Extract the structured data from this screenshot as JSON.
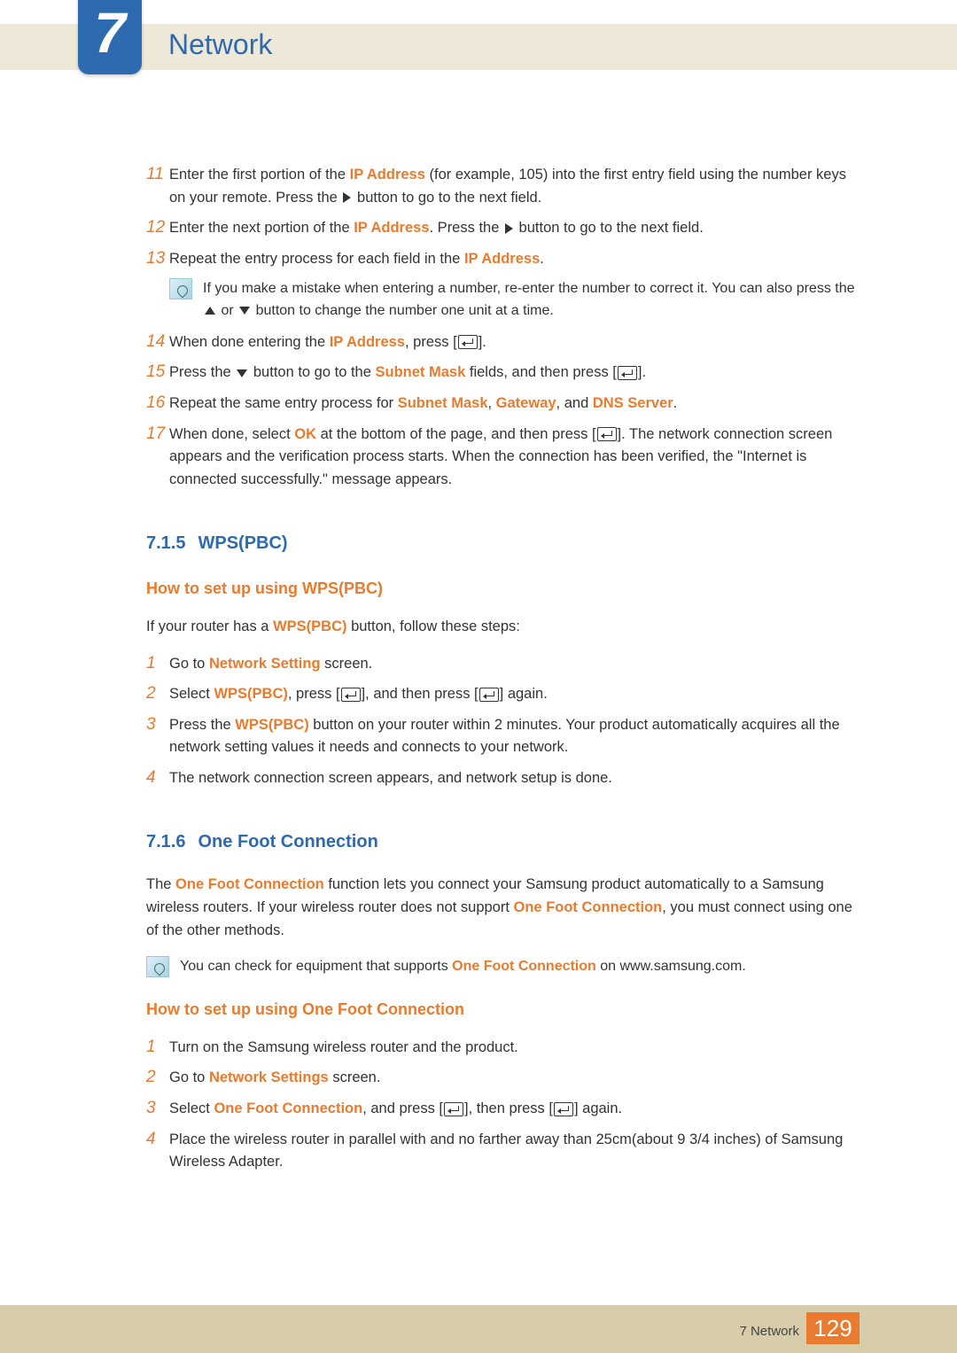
{
  "chapter": {
    "number": "7",
    "title": "Network"
  },
  "steps_a": [
    {
      "num": "11",
      "parts": [
        {
          "t": "Enter the first portion of the "
        },
        {
          "t": "IP Address",
          "c": "hl"
        },
        {
          "t": " (for example, 105) into the first entry field using the number keys on your remote. Press the "
        },
        {
          "icon": "tri-right"
        },
        {
          "t": " button to go to the next field."
        }
      ]
    },
    {
      "num": "12",
      "parts": [
        {
          "t": "Enter the next portion of the "
        },
        {
          "t": "IP Address",
          "c": "hl"
        },
        {
          "t": ". Press the "
        },
        {
          "icon": "tri-right"
        },
        {
          "t": " button to go to the next field."
        }
      ]
    },
    {
      "num": "13",
      "parts": [
        {
          "t": "Repeat the entry process for each field in the "
        },
        {
          "t": "IP Address",
          "c": "hl"
        },
        {
          "t": "."
        }
      ]
    }
  ],
  "note_a": [
    {
      "t": "If you make a mistake when entering a number, re-enter the number to correct it. You can also press the "
    },
    {
      "icon": "tri-up"
    },
    {
      "t": " or "
    },
    {
      "icon": "tri-down"
    },
    {
      "t": " button to change the number one unit at a time."
    }
  ],
  "steps_b": [
    {
      "num": "14",
      "parts": [
        {
          "t": "When done entering the "
        },
        {
          "t": "IP Address",
          "c": "hl"
        },
        {
          "t": ", press ["
        },
        {
          "icon": "enter"
        },
        {
          "t": "]."
        }
      ]
    },
    {
      "num": "15",
      "parts": [
        {
          "t": "Press the "
        },
        {
          "icon": "tri-down"
        },
        {
          "t": " button to go to the "
        },
        {
          "t": "Subnet Mask",
          "c": "hl"
        },
        {
          "t": " fields, and then press ["
        },
        {
          "icon": "enter"
        },
        {
          "t": "]."
        }
      ]
    },
    {
      "num": "16",
      "parts": [
        {
          "t": "Repeat the same entry process for "
        },
        {
          "t": "Subnet Mask",
          "c": "hl"
        },
        {
          "t": ", "
        },
        {
          "t": "Gateway",
          "c": "hl"
        },
        {
          "t": ", and "
        },
        {
          "t": "DNS Server",
          "c": "hl"
        },
        {
          "t": "."
        }
      ]
    },
    {
      "num": "17",
      "parts": [
        {
          "t": "When done, select "
        },
        {
          "t": "OK",
          "c": "hl"
        },
        {
          "t": " at the bottom of the page, and then press ["
        },
        {
          "icon": "enter"
        },
        {
          "t": "]. The network connection screen appears and the verification process starts. When the connection has been verified, the \"Internet is connected successfully.\" message appears."
        }
      ]
    }
  ],
  "section_wps": {
    "num": "7.1.5",
    "title": "WPS(PBC)"
  },
  "wps_subtitle": "How to set up using WPS(PBC)",
  "wps_intro": [
    {
      "t": "If your router has a "
    },
    {
      "t": "WPS(PBC)",
      "c": "hl"
    },
    {
      "t": " button, follow these steps:"
    }
  ],
  "wps_steps": [
    {
      "num": "1",
      "parts": [
        {
          "t": "Go to "
        },
        {
          "t": "Network Setting",
          "c": "hl"
        },
        {
          "t": " screen."
        }
      ]
    },
    {
      "num": "2",
      "parts": [
        {
          "t": "Select "
        },
        {
          "t": "WPS(PBC)",
          "c": "hl"
        },
        {
          "t": ", press ["
        },
        {
          "icon": "enter"
        },
        {
          "t": "], and then press ["
        },
        {
          "icon": "enter"
        },
        {
          "t": "] again."
        }
      ]
    },
    {
      "num": "3",
      "parts": [
        {
          "t": "Press the "
        },
        {
          "t": "WPS(PBC)",
          "c": "hl"
        },
        {
          "t": " button on your router within 2 minutes. Your product automatically acquires all the network setting values it needs and connects to your network."
        }
      ]
    },
    {
      "num": "4",
      "parts": [
        {
          "t": "The network connection screen appears, and network setup is done."
        }
      ]
    }
  ],
  "section_ofc": {
    "num": "7.1.6",
    "title": "One Foot Connection"
  },
  "ofc_intro": [
    {
      "t": "The "
    },
    {
      "t": "One Foot Connection",
      "c": "hl"
    },
    {
      "t": " function lets you connect your Samsung product automatically to a Samsung wireless routers. If your wireless router does not support "
    },
    {
      "t": "One Foot Connection",
      "c": "hl"
    },
    {
      "t": ", you must connect using one of the other methods."
    }
  ],
  "ofc_note": [
    {
      "t": "You can check for equipment that supports "
    },
    {
      "t": "One Foot Connection",
      "c": "hl"
    },
    {
      "t": " on www.samsung.com."
    }
  ],
  "ofc_subtitle": "How to set up using One Foot Connection",
  "ofc_steps": [
    {
      "num": "1",
      "parts": [
        {
          "t": "Turn on the Samsung wireless router and the product."
        }
      ]
    },
    {
      "num": "2",
      "parts": [
        {
          "t": "Go to "
        },
        {
          "t": "Network Settings",
          "c": "hl"
        },
        {
          "t": " screen."
        }
      ]
    },
    {
      "num": "3",
      "parts": [
        {
          "t": "Select "
        },
        {
          "t": "One Foot Connection",
          "c": "hl"
        },
        {
          "t": ", and press ["
        },
        {
          "icon": "enter"
        },
        {
          "t": "], then press ["
        },
        {
          "icon": "enter"
        },
        {
          "t": "] again."
        }
      ]
    },
    {
      "num": "4",
      "parts": [
        {
          "t": "Place the wireless router in parallel with and no farther away than 25cm(about 9 3/4 inches) of Samsung Wireless Adapter."
        }
      ]
    }
  ],
  "footer": {
    "label": "7 Network",
    "page": "129"
  }
}
